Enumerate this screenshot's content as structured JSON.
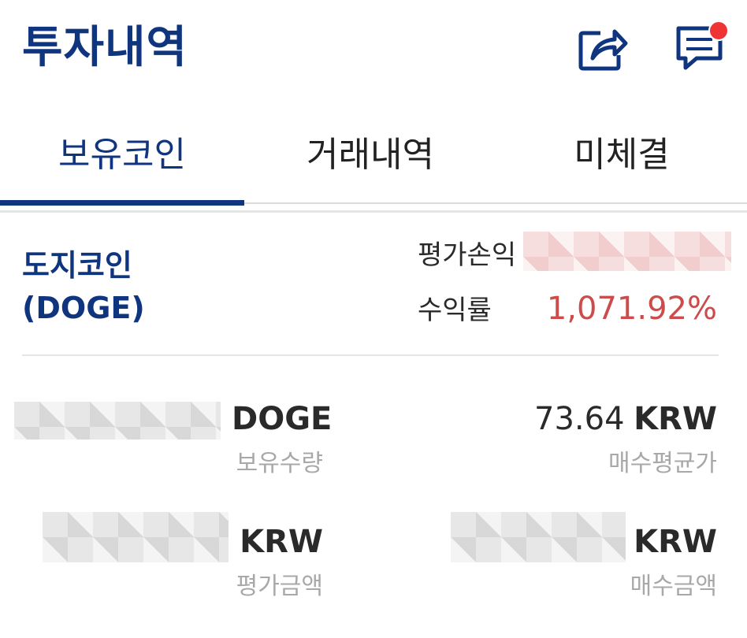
{
  "header": {
    "title": "투자내역",
    "share_icon": "share-icon",
    "chat_icon": "chat-icon",
    "notification_dot_color": "#ee3434"
  },
  "tabs": [
    {
      "label": "보유코인",
      "active": true
    },
    {
      "label": "거래내역",
      "active": false
    },
    {
      "label": "미체결",
      "active": false
    }
  ],
  "coin": {
    "name": "도지코인",
    "ticker": "(DOGE)",
    "eval_profit_label": "평가손익",
    "return_label": "수익률",
    "return_value": "1,071.92%"
  },
  "holdings": {
    "quantity_unit": "DOGE",
    "quantity_label": "보유수량",
    "avg_price_value": "73.64",
    "avg_price_unit": "KRW",
    "avg_price_label": "매수평균가",
    "eval_amount_unit": "KRW",
    "eval_amount_label": "평가금액",
    "buy_amount_unit": "KRW",
    "buy_amount_label": "매수금액"
  },
  "colors": {
    "brand": "#10357f",
    "return_positive": "#cc4b4b",
    "muted": "#a8a8a8"
  }
}
